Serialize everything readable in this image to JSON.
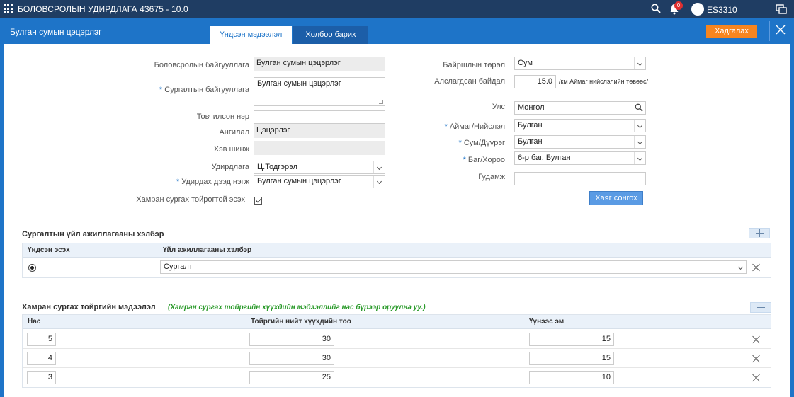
{
  "topbar": {
    "title": "БОЛОВСРОЛЫН УДИРДЛАГА 43675 - 10.0",
    "notification_count": "0",
    "user": "ES3310",
    "icons": [
      "apps-grid-icon",
      "search-icon",
      "bell-icon",
      "user-avatar-icon",
      "messages-icon"
    ]
  },
  "header": {
    "page_title": "Булган сумын цэцэрлэг",
    "tabs": [
      {
        "label": "Үндсэн мэдээлэл",
        "active": true
      },
      {
        "label": "Холбоо барих",
        "active": false
      }
    ],
    "save_label": "Хадгалах"
  },
  "form_left": {
    "org_label": "Боловсролын байгууллага",
    "org_value": "Булган сумын цэцэрлэг",
    "school_label": "Сургалтын байгууллага",
    "school_value": "Булган сумын цэцэрлэг",
    "short_name_label": "Товчилсон нэр",
    "short_name_value": "",
    "category_label": "Ангилал",
    "category_value": "Цэцэрлэг",
    "ownership_label": "Хэв шинж",
    "ownership_value": "",
    "director_label": "Удирдлага",
    "director_value": "Ц.Тодгэрэл",
    "parent_unit_label": "Удирдах дээд нэгж",
    "parent_unit_value": "Булган сумын цэцэрлэг",
    "group_label": "Хамран сургах тойрогтой эсэх",
    "group_checked": true
  },
  "form_right": {
    "loc_type_label": "Байршлын төрөл",
    "loc_type_value": "Сум",
    "distance_label": "Алслагдсан байдал",
    "distance_value": "15.0",
    "distance_unit": "/км Аймаг нийслэлийн төвөөс/",
    "country_label": "Улс",
    "country_value": "Монгол",
    "province_label": "Аймаг/Нийслэл",
    "province_value": "Булган",
    "district_label": "Сум/Дүүрэг",
    "district_value": "Булган",
    "khoroo_label": "Баг/Хороо",
    "khoroo_value": "6-р баг, Булган",
    "street_label": "Гудамж",
    "street_value": "",
    "address_btn": "Хаяг сонгох"
  },
  "activity": {
    "title": "Сургалтын үйл ажиллагааны хэлбэр",
    "col_main": "Үндсэн эсэх",
    "col_form": "Үйл ажиллагааны хэлбэр",
    "rows": [
      {
        "main": true,
        "form": "Сургалт"
      }
    ]
  },
  "district_info": {
    "title": "Хамран сургах тойргийн мэдээлэл",
    "note": "(Хамран сургах тойргийн хүүхдийн мэдээллийг нас бүрээр оруулна уу.)",
    "col_age": "Нас",
    "col_total": "Тойргийн нийт хүүхдийн тоо",
    "col_female": "Үүнээс эм",
    "rows": [
      {
        "age": "5",
        "total": "30",
        "female": "15"
      },
      {
        "age": "4",
        "total": "30",
        "female": "15"
      },
      {
        "age": "3",
        "total": "25",
        "female": "10"
      }
    ]
  }
}
